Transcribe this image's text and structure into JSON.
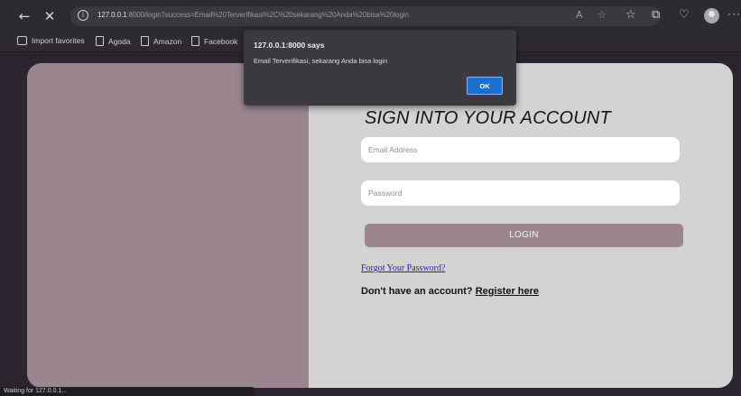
{
  "browser": {
    "url_host": "127.0.0.1",
    "url_rest": ":8000/login?success=Email%20Terverifikasi%2C%20sekarang%20Anda%20bisa%20login",
    "bookmarks": [
      "Import favorites",
      "Agoda",
      "Amazon",
      "Facebook"
    ]
  },
  "form": {
    "title": "SIGN INTO YOUR ACCOUNT",
    "email_placeholder": "Email Address",
    "password_placeholder": "Password",
    "login_label": "LOGIN",
    "forgot_link": "Forgot Your Password?",
    "register_prompt": "Don't have an account? ",
    "register_link": "Register here"
  },
  "dialog": {
    "title": "127.0.0.1:8000 says",
    "message": "Email Terverifikasi, sekarang Anda bisa login",
    "ok_label": "OK"
  },
  "status": {
    "text": "Waiting for 127.0.0.1..."
  },
  "colors": {
    "accent_mauve": "#9b8690",
    "panel_gray": "#d3d3d3",
    "dialog_button": "#1a6fd1",
    "link_blue": "#1f1bd0"
  }
}
